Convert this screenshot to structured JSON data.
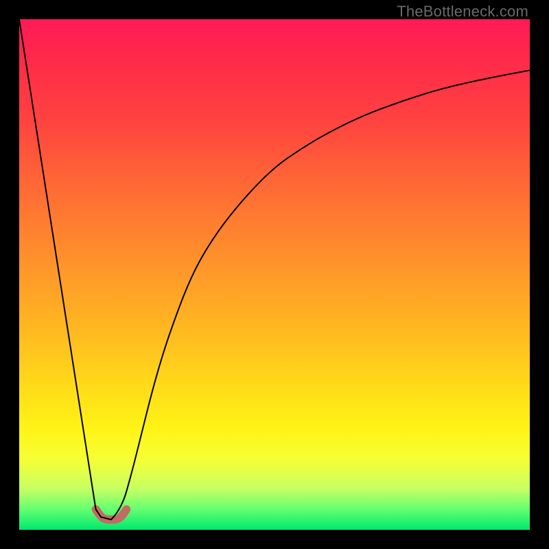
{
  "watermark": "TheBottleneck.com",
  "chart_data": {
    "type": "line",
    "title": "",
    "xlabel": "",
    "ylabel": "",
    "xlim": [
      0,
      100
    ],
    "ylim": [
      0,
      100
    ],
    "grid": false,
    "legend": false,
    "series": [
      {
        "name": "left-slope",
        "x": [
          0,
          15,
          16,
          18
        ],
        "values": [
          100,
          4,
          2.5,
          2
        ]
      },
      {
        "name": "valley-marker",
        "x": [
          15,
          16,
          17,
          18,
          19,
          20,
          21
        ],
        "values": [
          4,
          2.5,
          2,
          2,
          2,
          2.5,
          4
        ]
      },
      {
        "name": "right-curve",
        "x": [
          18,
          20,
          22,
          24,
          26,
          28,
          30,
          33,
          36,
          40,
          45,
          50,
          55,
          60,
          67,
          75,
          83,
          92,
          100
        ],
        "values": [
          2,
          4,
          11,
          19,
          27,
          34,
          40,
          48,
          54,
          60,
          66,
          71,
          74.5,
          77.5,
          81,
          84,
          86.5,
          88.5,
          90
        ]
      }
    ],
    "colors": {
      "curve": "#000000",
      "valley_marker": "#c26b62"
    }
  }
}
